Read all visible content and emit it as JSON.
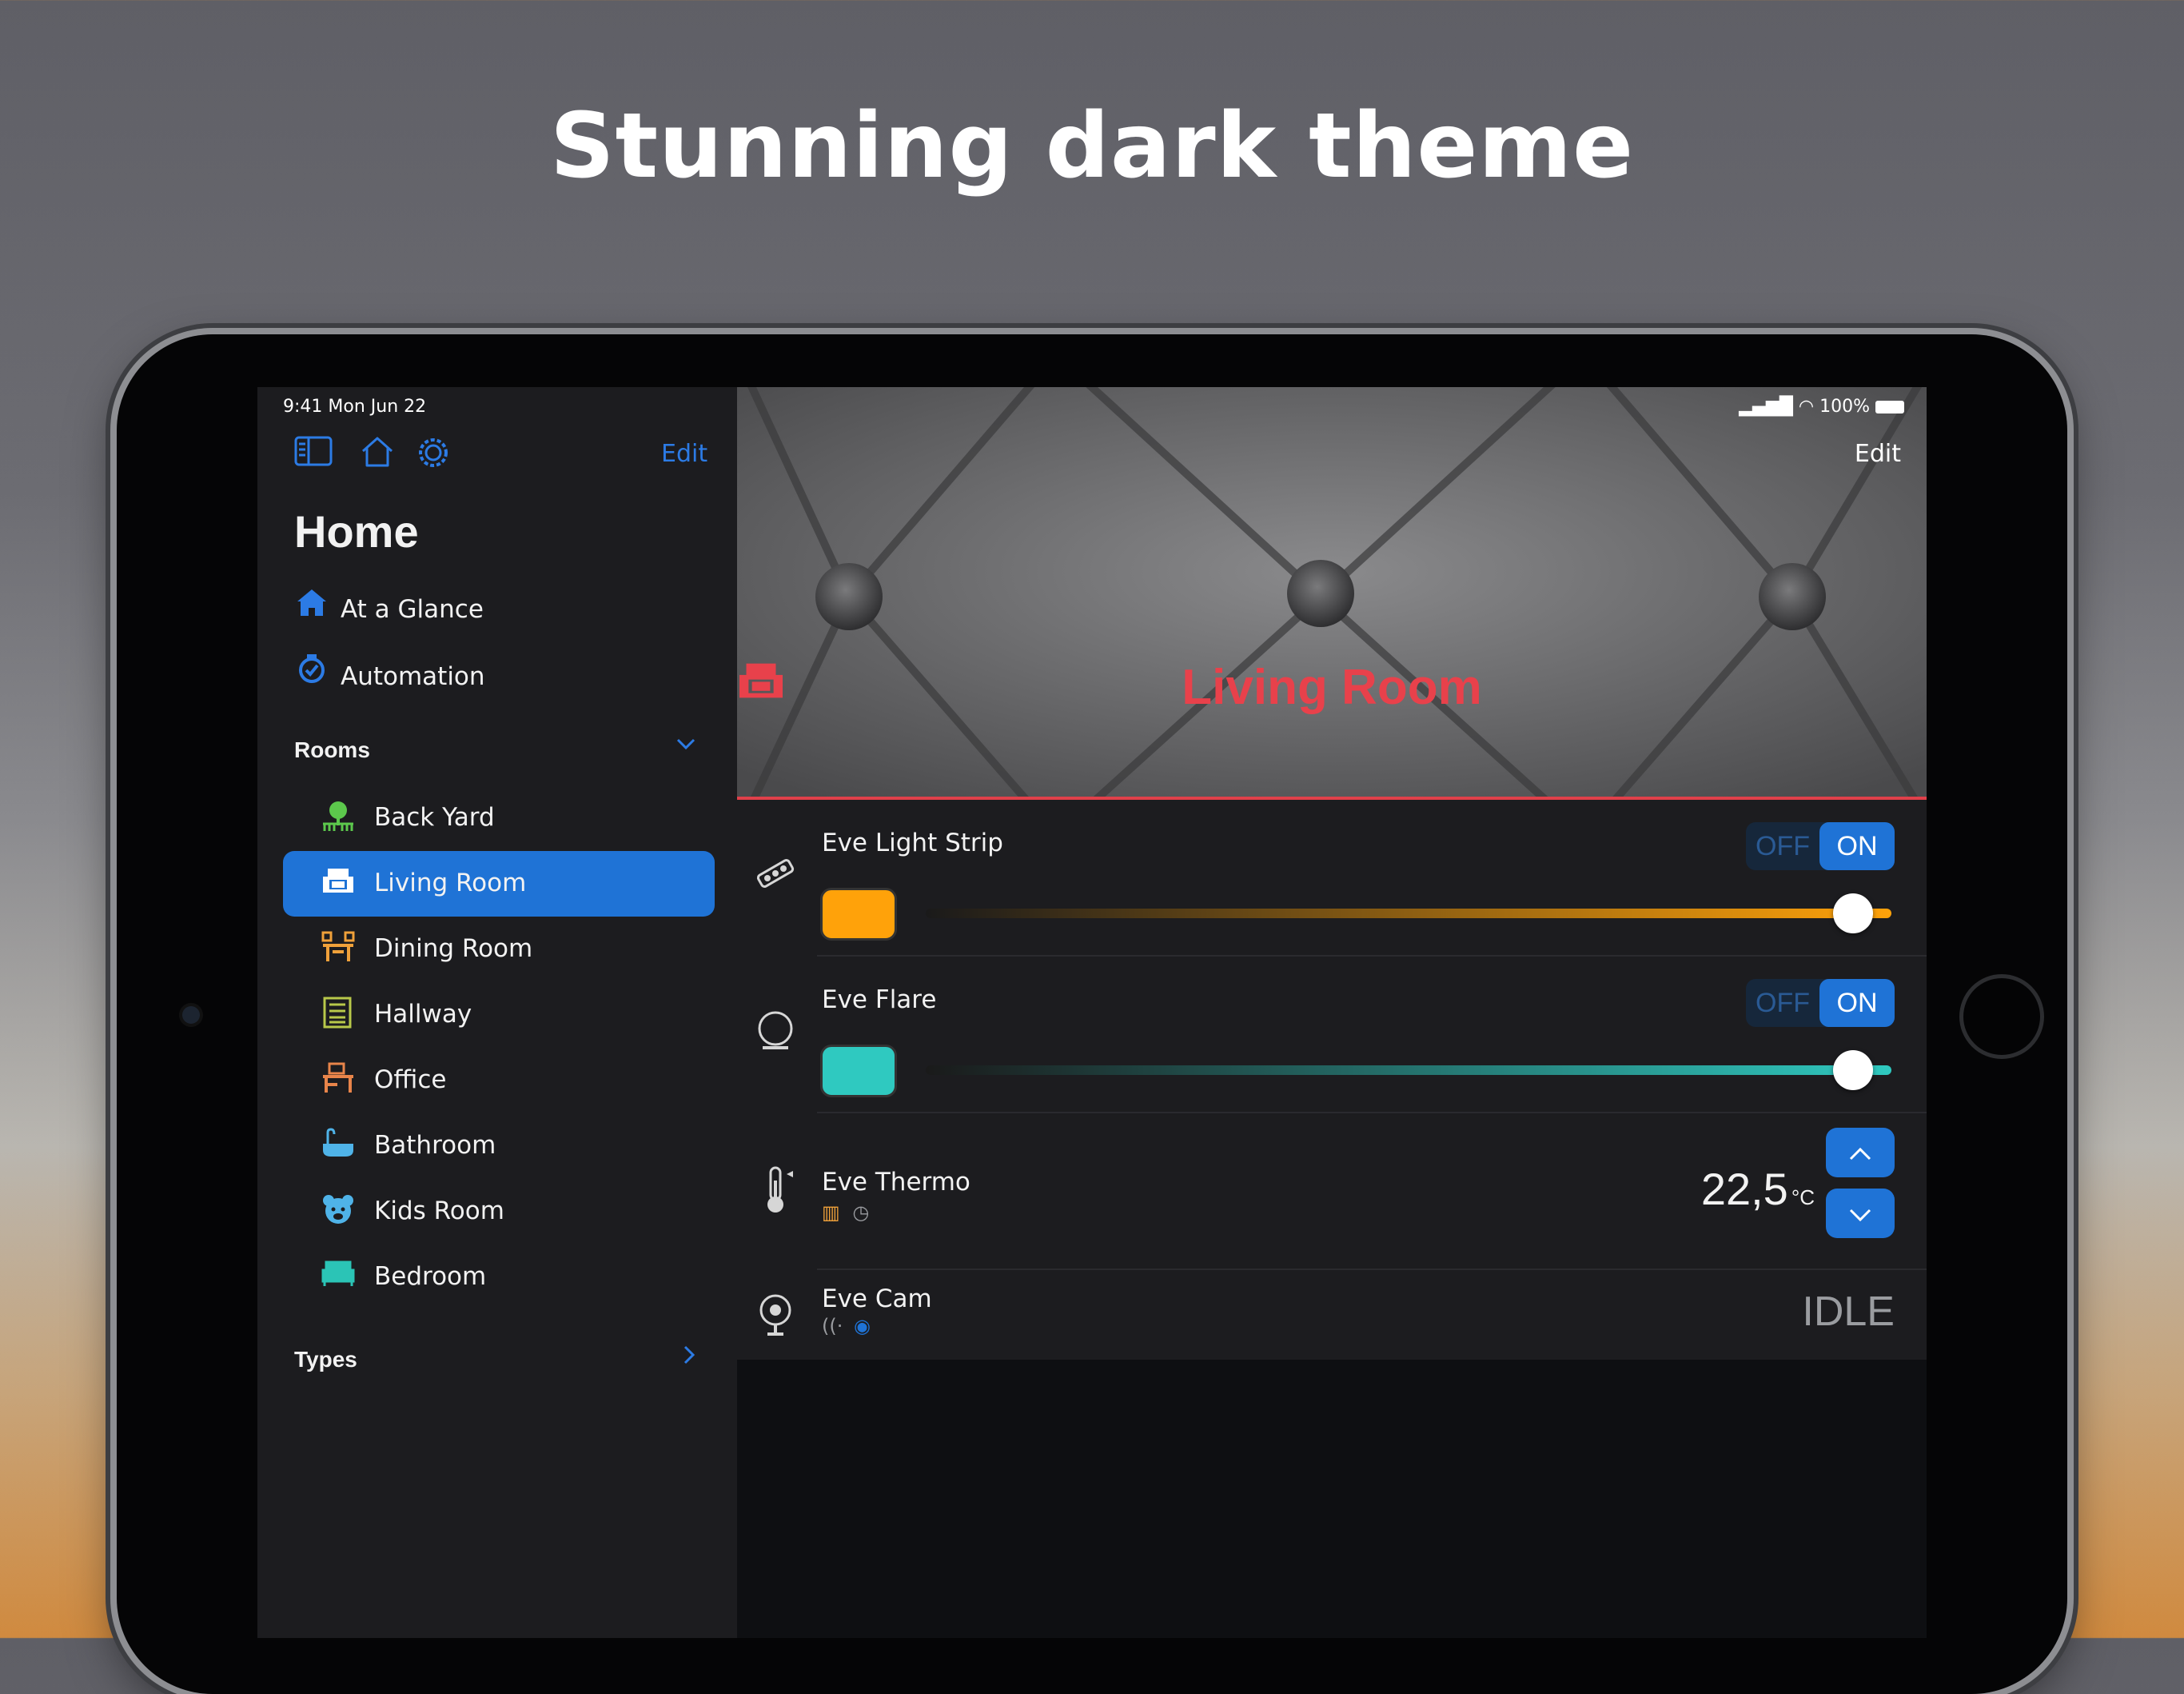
{
  "headline": "Stunning dark theme",
  "status": {
    "time": "9:41  Mon Jun 22",
    "battery": "100%"
  },
  "sidebar": {
    "edit_label": "Edit",
    "home_title": "Home",
    "nav": [
      {
        "label": "At a Glance",
        "icon": "house-icon"
      },
      {
        "label": "Automation",
        "icon": "automation-icon"
      }
    ],
    "rooms_header": "Rooms",
    "rooms": [
      {
        "label": "Back Yard",
        "icon": "tree-icon",
        "color": "#5cc84c"
      },
      {
        "label": "Living Room",
        "icon": "armchair-icon",
        "color": "#ffffff"
      },
      {
        "label": "Dining Room",
        "icon": "dining-table-icon",
        "color": "#f0a13a"
      },
      {
        "label": "Hallway",
        "icon": "door-icon",
        "color": "#b8c84a"
      },
      {
        "label": "Office",
        "icon": "desk-icon",
        "color": "#e8844a"
      },
      {
        "label": "Bathroom",
        "icon": "bathtub-icon",
        "color": "#4fb3e8"
      },
      {
        "label": "Kids Room",
        "icon": "teddy-bear-icon",
        "color": "#4fb3e8"
      },
      {
        "label": "Bedroom",
        "icon": "bed-icon",
        "color": "#2bc4b6"
      }
    ],
    "types_header": "Types"
  },
  "main": {
    "edit_label": "Edit",
    "room_title": "Living Room",
    "accent": "#e8414b",
    "devices": [
      {
        "name": "Eve Light Strip",
        "off_label": "OFF",
        "on_label": "ON",
        "swatch": "#ffa20a",
        "brightness": 0.96
      },
      {
        "name": "Eve Flare",
        "off_label": "OFF",
        "on_label": "ON",
        "swatch": "#2fc9c0",
        "brightness": 0.96
      },
      {
        "name": "Eve Thermo",
        "temperature": "22,5",
        "unit": "°C"
      },
      {
        "name": "Eve Cam",
        "state": "IDLE"
      }
    ]
  }
}
